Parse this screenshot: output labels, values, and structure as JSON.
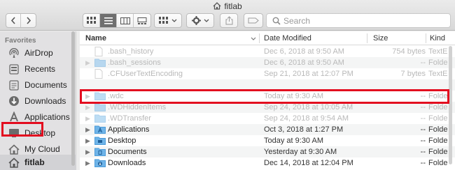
{
  "window": {
    "title": "fitlab"
  },
  "search": {
    "placeholder": "Search"
  },
  "sidebar": {
    "section_title": "Favorites",
    "items": [
      {
        "label": "AirDrop",
        "icon": "airdrop-icon"
      },
      {
        "label": "Recents",
        "icon": "recents-icon"
      },
      {
        "label": "Documents",
        "icon": "documents-icon"
      },
      {
        "label": "Downloads",
        "icon": "downloads-icon"
      },
      {
        "label": "Applications",
        "icon": "applications-icon"
      },
      {
        "label": "Desktop",
        "icon": "desktop-icon"
      },
      {
        "label": "My Cloud",
        "icon": "home-icon"
      },
      {
        "label": "fitlab",
        "icon": "home-icon",
        "selected": true
      }
    ]
  },
  "columns": {
    "name": "Name",
    "date": "Date Modified",
    "size": "Size",
    "kind": "Kind"
  },
  "files": [
    {
      "name": ".bash_history",
      "date": "Dec 6, 2018 at 9:50 AM",
      "size": "754 bytes",
      "kind": "TextE",
      "type": "file",
      "hidden": true
    },
    {
      "name": ".bash_sessions",
      "date": "Dec 6, 2018 at 9:50 AM",
      "size": "--",
      "kind": "Folde",
      "type": "folder",
      "hidden": true
    },
    {
      "name": ".CFUserTextEncoding",
      "date": "Sep 21, 2018 at 12:07 PM",
      "size": "7 bytes",
      "kind": "TextE",
      "type": "file",
      "hidden": true
    },
    {
      "name": "",
      "date": "",
      "size": "",
      "kind": "",
      "type": "blank",
      "hidden": true
    },
    {
      "name": ".wdc",
      "date": "Today at 9:30 AM",
      "size": "--",
      "kind": "Folde",
      "type": "folder",
      "hidden": true
    },
    {
      "name": ".WDHiddenItems",
      "date": "Sep 24, 2018 at 10:05 AM",
      "size": "--",
      "kind": "Folde",
      "type": "folder",
      "hidden": true
    },
    {
      "name": ".WDTransfer",
      "date": "Sep 24, 2018 at 9:54 AM",
      "size": "--",
      "kind": "Folde",
      "type": "folder",
      "hidden": true
    },
    {
      "name": "Applications",
      "date": "Oct 3, 2018 at 1:27 PM",
      "size": "--",
      "kind": "Folde",
      "type": "apps-folder",
      "hidden": false
    },
    {
      "name": "Desktop",
      "date": "Today at 9:30 AM",
      "size": "--",
      "kind": "Folde",
      "type": "desktop-folder",
      "hidden": false
    },
    {
      "name": "Documents",
      "date": "Yesterday at 9:30 AM",
      "size": "--",
      "kind": "Folde",
      "type": "docs-folder",
      "hidden": false
    },
    {
      "name": "Downloads",
      "date": "Dec 14, 2018 at 12:04 PM",
      "size": "--",
      "kind": "Folde",
      "type": "downloads-folder",
      "hidden": false
    }
  ],
  "colors": {
    "highlight": "#e30c1f",
    "folder": "#6fb4e8",
    "selection": "#d2d2d5"
  }
}
